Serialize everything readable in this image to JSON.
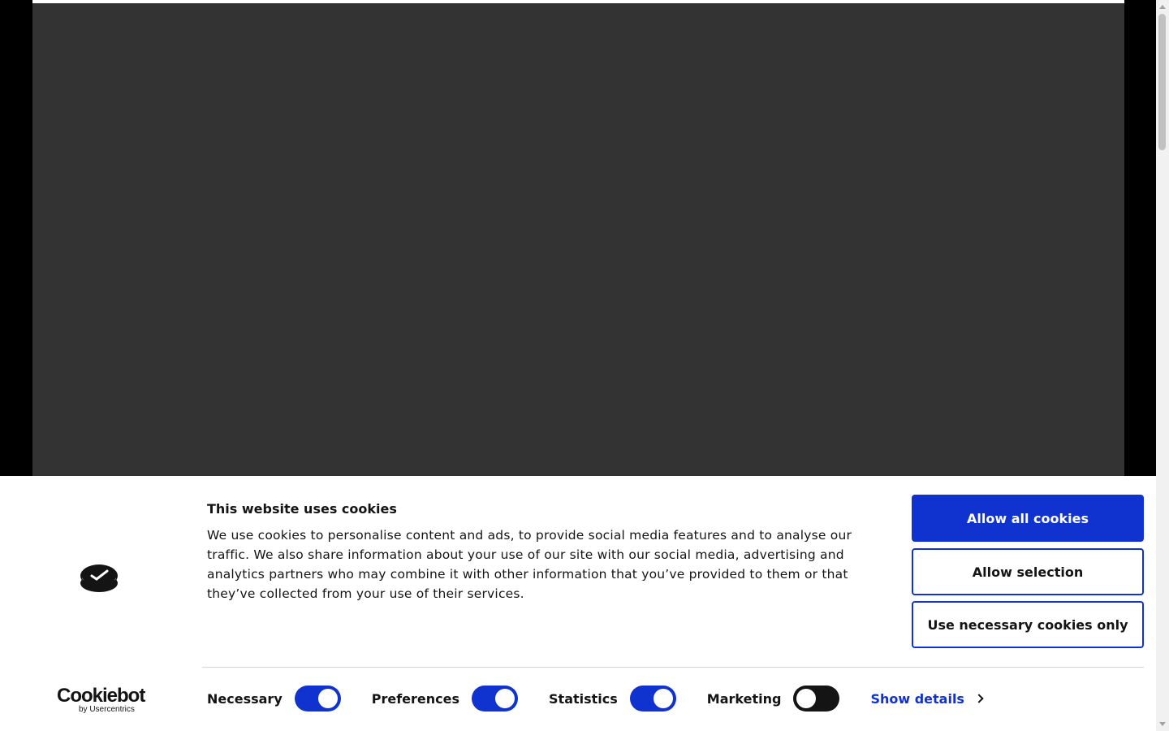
{
  "banner": {
    "title": "This website uses cookies",
    "description": "We use cookies to personalise content and ads, to provide social media features and to analyse our traffic. We also share information about your use of our site with our social media, advertising and analytics partners who may combine it with other information that you’ve provided to them or that they’ve collected from your use of their services.",
    "buttons": {
      "allow_all": "Allow all cookies",
      "allow_selection": "Allow selection",
      "necessary_only": "Use necessary cookies only"
    },
    "toggles": [
      {
        "label": "Necessary",
        "state": "on"
      },
      {
        "label": "Preferences",
        "state": "on"
      },
      {
        "label": "Statistics",
        "state": "on"
      },
      {
        "label": "Marketing",
        "state": "off"
      }
    ],
    "show_details": "Show details",
    "brand": {
      "name": "Cookiebot",
      "sub": "by Usercentrics"
    }
  },
  "colors": {
    "accent": "#1032cf",
    "video_bg": "#333333",
    "text": "#141414"
  }
}
